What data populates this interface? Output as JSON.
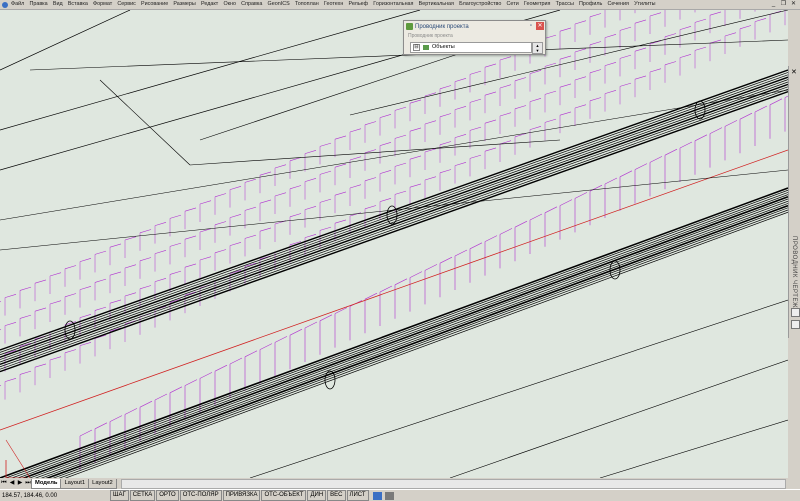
{
  "menu": {
    "items": [
      "Файл",
      "Правка",
      "Вид",
      "Вставка",
      "Формат",
      "Сервис",
      "Рисование",
      "Размеры",
      "Редакт",
      "Окно",
      "Справка",
      "GeonICS",
      "Топоплан",
      "Геотехн",
      "Рельеф",
      "Горизонтальная",
      "Вертикальная",
      "Благоустройство",
      "Сети",
      "Геометрия",
      "Трассы",
      "Профиль",
      "Сечения",
      "Утилиты"
    ]
  },
  "palette": {
    "title": "Проводник проекта",
    "subtitle": "Проводник проекта",
    "tree_item": "Объекты",
    "tree_toggle": "⊟"
  },
  "side_panel": {
    "title": "ПРОВОДНИК ЧЕРТЕЖА"
  },
  "layout_tabs": [
    "Модель",
    "Layout1",
    "Layout2"
  ],
  "status": {
    "coords": "184.57, 184.46, 0.00",
    "buttons": [
      "ШАГ",
      "СЕТКА",
      "ОРТО",
      "ОТС-ПОЛЯР",
      "ПРИВЯЗКА",
      "ОТС-ОБЪЕКТ",
      "ДИН",
      "ВЕС",
      "ЛИСТ"
    ]
  },
  "colors": {
    "background": "#dfe7df",
    "linework": "#000000",
    "magenta": "#b030d0",
    "red": "#d02020"
  }
}
